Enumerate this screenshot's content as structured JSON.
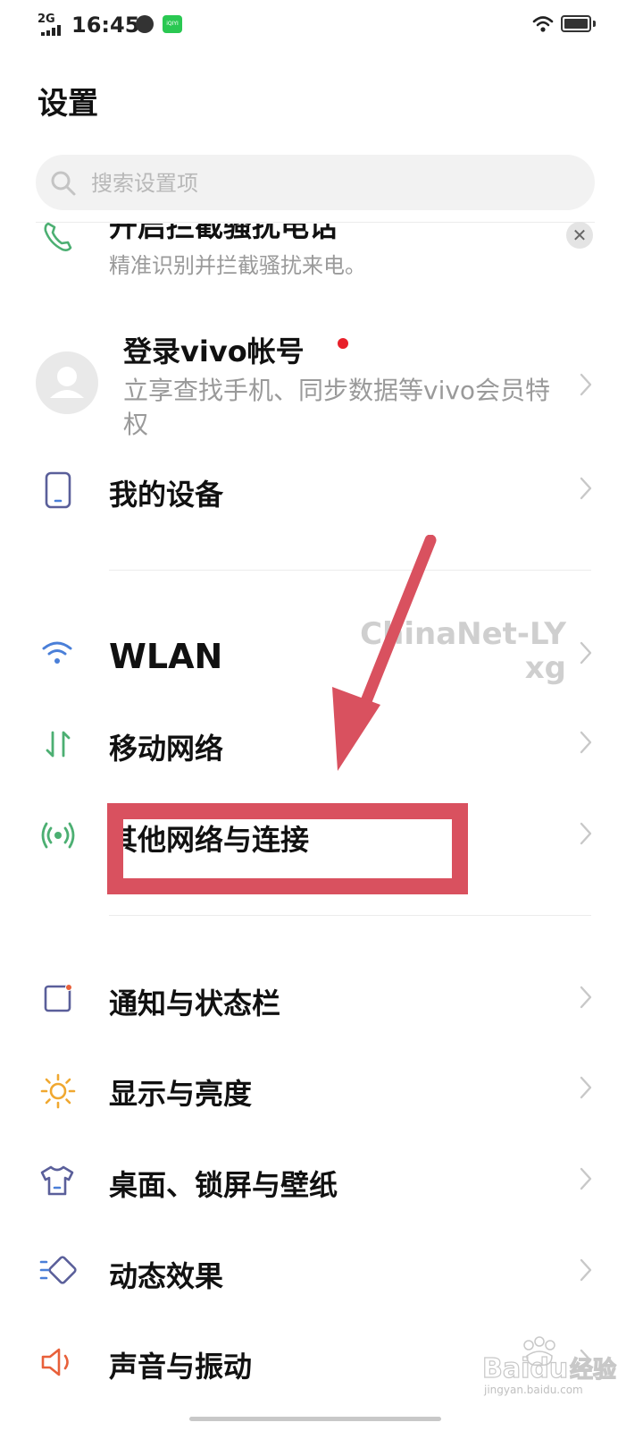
{
  "status_bar": {
    "network": "2G",
    "time": "16:45",
    "iqiyi_label": "iQIYI"
  },
  "header": {
    "title": "设置",
    "search_placeholder": "搜索设置项"
  },
  "banner": {
    "title": "开启拦截骚扰电话",
    "subtitle": "精准识别并拦截骚扰来电。",
    "close_symbol": "✕"
  },
  "account": {
    "title": "登录vivo帐号",
    "subtitle": "立享查找手机、同步数据等vivo会员特权"
  },
  "rows": {
    "my_device": "我的设备",
    "wlan": "WLAN",
    "wlan_value": "ChinaNet-LYxg",
    "mobile_network": "移动网络",
    "other_network": "其他网络与连接",
    "notification": "通知与状态栏",
    "display": "显示与亮度",
    "desktop": "桌面、锁屏与壁纸",
    "animation": "动态效果",
    "sound": "声音与振动"
  },
  "watermark": {
    "brand": "Baidu",
    "cn": "经验",
    "url": "jingyan.baidu.com"
  },
  "colors": {
    "annotation_red": "#d9515f",
    "green_icon": "#4caf72",
    "blue_icon": "#4a7fd8",
    "purple_icon": "#5a5f9a",
    "orange_icon": "#f0a830",
    "red_dot": "#e8202a"
  }
}
